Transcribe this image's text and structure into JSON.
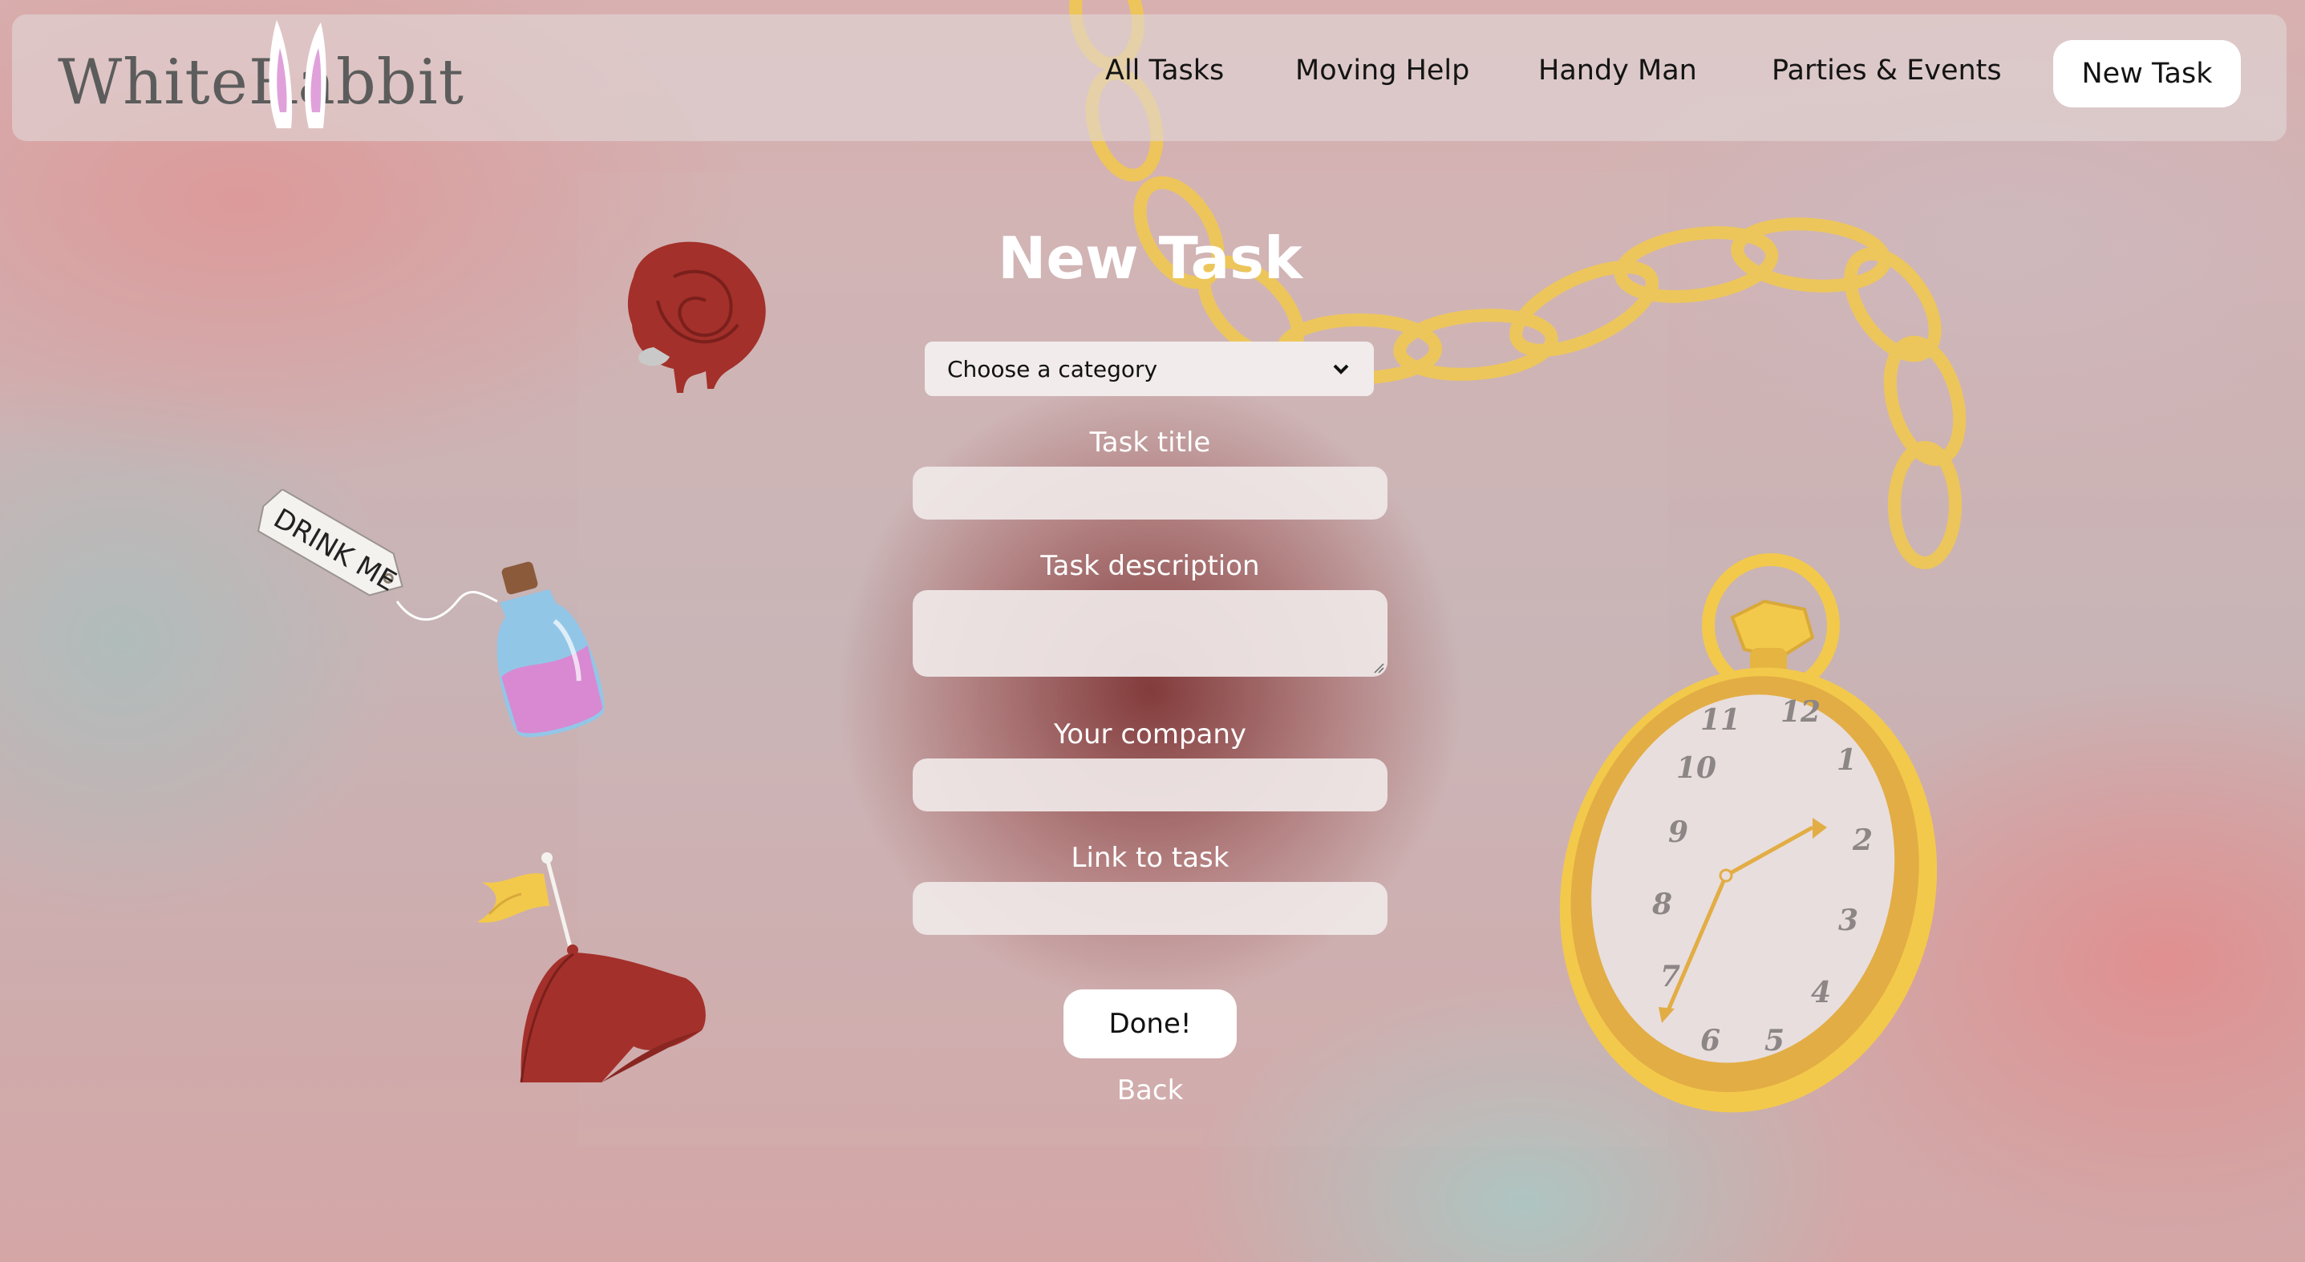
{
  "header": {
    "logo_text": "WhiteRabbit",
    "nav": [
      {
        "label": "All Tasks"
      },
      {
        "label": "Moving Help"
      },
      {
        "label": "Handy Man"
      },
      {
        "label": "Parties & Events"
      }
    ],
    "cta_label": "New Task"
  },
  "form": {
    "title": "New Task",
    "category_select": {
      "selected": "Choose a category"
    },
    "fields": {
      "task_title": {
        "label": "Task title",
        "value": ""
      },
      "task_description": {
        "label": "Task description",
        "value": ""
      },
      "company": {
        "label": "Your company",
        "value": ""
      },
      "link": {
        "label": "Link to task",
        "value": ""
      }
    },
    "submit_label": "Done!",
    "back_label": "Back"
  },
  "decorations": {
    "tag_text": "DRINK ME",
    "clock_numbers": [
      "12",
      "1",
      "2",
      "3",
      "4",
      "5",
      "6",
      "7",
      "8",
      "9",
      "10",
      "11"
    ]
  },
  "colors": {
    "gold": "#f3c94b",
    "crimson": "#a3302a",
    "potion_pink": "#d889d2",
    "bottle_blue": "#8fc7ea",
    "white": "#ffffff"
  },
  "icons": {
    "rose": "rose-icon",
    "potion": "potion-bottle-icon",
    "hat": "red-cap-icon",
    "watch": "pocket-watch-icon",
    "select_chevron": "chevron-down-icon"
  }
}
